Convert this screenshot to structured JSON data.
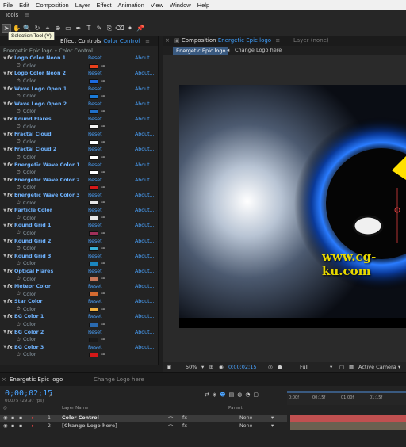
{
  "menu": [
    "File",
    "Edit",
    "Composition",
    "Layer",
    "Effect",
    "Animation",
    "View",
    "Window",
    "Help"
  ],
  "tools": {
    "title": "Tools",
    "tooltip": "Selection Tool (V)",
    "icons": [
      "selection-tool-icon",
      "hand-tool-icon",
      "zoom-tool-icon",
      "rotation-tool-icon",
      "camera-tool-icon",
      "pan-behind-tool-icon",
      "rectangle-tool-icon",
      "pen-tool-icon",
      "type-tool-icon",
      "brush-tool-icon",
      "clone-stamp-tool-icon",
      "eraser-tool-icon",
      "roto-brush-tool-icon",
      "puppet-tool-icon"
    ]
  },
  "effect_controls": {
    "tab_label": "Effect Controls",
    "layer_name": "Color Control",
    "breadcrumb": "Energetic Epic logo • Color Control",
    "reset_label": "Reset",
    "about_label": "About...",
    "param_label": "Color",
    "effects": [
      {
        "name": "Logo Color Neon 1",
        "color": "#e8401c"
      },
      {
        "name": "Logo Color Neon 2",
        "color": "#1c6ae0"
      },
      {
        "name": "Wave Logo Open 1",
        "color": "#1a7ad8"
      },
      {
        "name": "Wave Logo Open 2",
        "color": "#1f6fc8"
      },
      {
        "name": "Round Flares",
        "color": "#f2f2f2"
      },
      {
        "name": "Fractal Cloud",
        "color": "#ffffff"
      },
      {
        "name": "Fractal Cloud 2",
        "color": "#ffffff"
      },
      {
        "name": "Energetic Wave Color 1",
        "color": "#ffffff"
      },
      {
        "name": "Energetic Wave Color 2",
        "color": "#d41818"
      },
      {
        "name": "Energetic Wave Color 3",
        "color": "#e6e6e6"
      },
      {
        "name": "Particle Color",
        "color": "#e8e8e8"
      },
      {
        "name": "Round Grid 1",
        "color": "#a0305a"
      },
      {
        "name": "Round Grid 2",
        "color": "#38b0d8"
      },
      {
        "name": "Round Grid 3",
        "color": "#1a86c0"
      },
      {
        "name": "Optical Flares",
        "color": "#c8785a"
      },
      {
        "name": "Meteor Color",
        "color": "#d46a30"
      },
      {
        "name": "Star Color",
        "color": "#f0b040"
      },
      {
        "name": "BG Color 1",
        "color": "#2a6ab0"
      },
      {
        "name": "BG Color 2",
        "color": "#1a1a1a"
      },
      {
        "name": "BG Color 3",
        "color": "#d41818"
      }
    ]
  },
  "composition": {
    "tab_label": "Composition",
    "comp_name": "Energetic Epic logo",
    "layer_tab": "Layer (none)",
    "crumb_active": "Energetic Epic logo",
    "crumb_next": "Change Logo here",
    "watermark": "www.cg-ku.com",
    "zoom": "50%",
    "timecode": "0;00;02;15",
    "resolution": "Full",
    "view": "Active Camera"
  },
  "timeline": {
    "tab1": "Energetic Epic logo",
    "tab2": "Change Logo here",
    "timecode": "0;00;02;15",
    "frames": "00075 (29.97 fps)",
    "col_layer_name": "Layer Name",
    "col_parent": "Parent",
    "ruler_ticks": [
      "0:00f",
      "00:15f",
      "01:00f",
      "01:15f"
    ],
    "layers": [
      {
        "num": "1",
        "name": "Color Control",
        "parent": "None",
        "bar_color": "#c05050"
      },
      {
        "num": "2",
        "name": "[Change Logo here]",
        "parent": "None",
        "bar_color": "#6a6050"
      }
    ]
  },
  "colors": {
    "accent_blue": "#4aa3ff",
    "panel_bg": "#232323"
  }
}
